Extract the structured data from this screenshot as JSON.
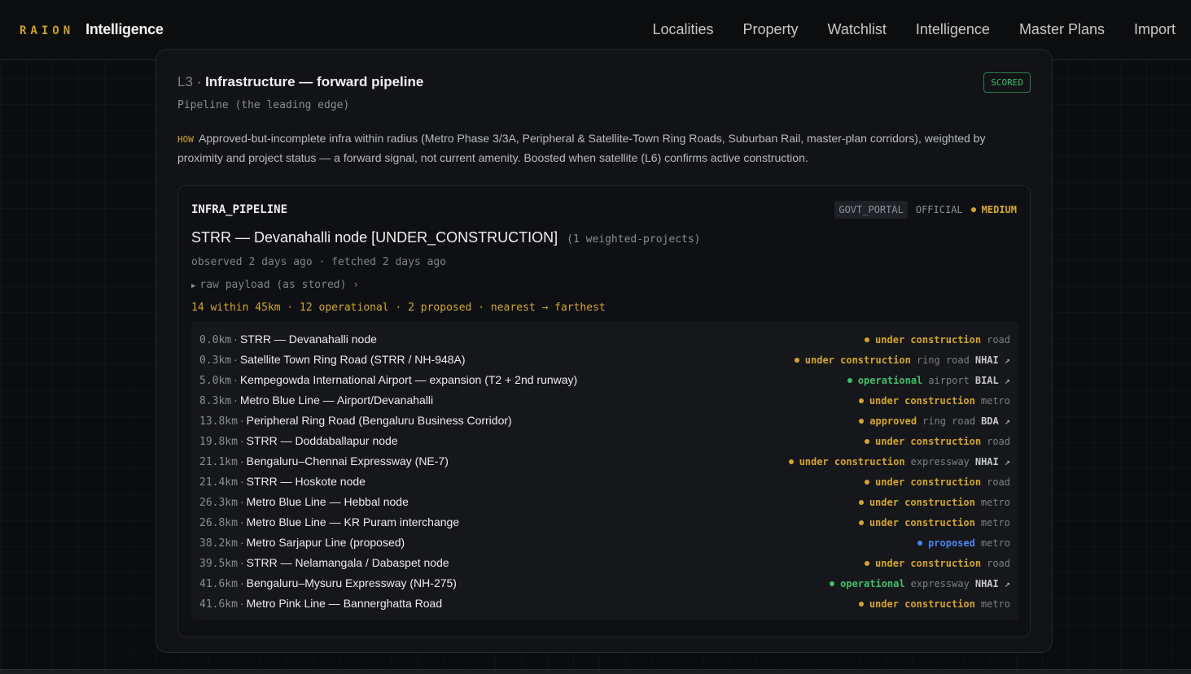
{
  "brand": {
    "prefix": "RAION",
    "name": "Intelligence"
  },
  "nav": [
    "Localities",
    "Property",
    "Watchlist",
    "Intelligence",
    "Master Plans",
    "Import"
  ],
  "colors": {
    "accent": "#d4a52a",
    "operational": "#3fbf6a",
    "proposed": "#4a86f0",
    "under_construction": "#d4a52a",
    "approved": "#d4a52a"
  },
  "card": {
    "level": "L3",
    "separator": "·",
    "title": "Infrastructure — forward pipeline",
    "badge": "SCORED",
    "subtitle": "Pipeline (the leading edge)",
    "how_tag": "HOW",
    "how_text": "Approved-but-incomplete infra within radius (Metro Phase 3/3A, Peripheral & Satellite-Town Ring Roads, Suburban Rail, master-plan corridors), weighted by proximity and project status — a forward signal, not current amenity. Boosted when satellite (L6) confirms active construction."
  },
  "panel": {
    "source_id": "INFRA_PIPELINE",
    "tag_portal": "GOVT_PORTAL",
    "tag_official": "OFFICIAL",
    "tag_confidence": "MEDIUM",
    "signal": "STRR — Devanahalli node [UNDER_CONSTRUCTION]",
    "signal_count": "(1 weighted-projects)",
    "meta": "observed 2 days ago · fetched 2 days ago",
    "raw_label": "raw payload (as stored) ›",
    "summary": "14 within 45km · 12 operational · 2 proposed · nearest → farthest"
  },
  "projects": [
    {
      "dist": "0.0km",
      "name": "STRR — Devanahalli node",
      "status": "under construction",
      "status_key": "under_construction",
      "kind": "road",
      "agency": "",
      "link": false
    },
    {
      "dist": "0.3km",
      "name": "Satellite Town Ring Road (STRR / NH-948A)",
      "status": "under construction",
      "status_key": "under_construction",
      "kind": "ring road",
      "agency": "NHAI",
      "link": true
    },
    {
      "dist": "5.0km",
      "name": "Kempegowda International Airport — expansion (T2 + 2nd runway)",
      "status": "operational",
      "status_key": "operational",
      "kind": "airport",
      "agency": "BIAL",
      "link": true
    },
    {
      "dist": "8.3km",
      "name": "Metro Blue Line — Airport/Devanahalli",
      "status": "under construction",
      "status_key": "under_construction",
      "kind": "metro",
      "agency": "",
      "link": false
    },
    {
      "dist": "13.8km",
      "name": "Peripheral Ring Road (Bengaluru Business Corridor)",
      "status": "approved",
      "status_key": "approved",
      "kind": "ring road",
      "agency": "BDA",
      "link": true
    },
    {
      "dist": "19.8km",
      "name": "STRR — Doddaballapur node",
      "status": "under construction",
      "status_key": "under_construction",
      "kind": "road",
      "agency": "",
      "link": false
    },
    {
      "dist": "21.1km",
      "name": "Bengaluru–Chennai Expressway (NE-7)",
      "status": "under construction",
      "status_key": "under_construction",
      "kind": "expressway",
      "agency": "NHAI",
      "link": true
    },
    {
      "dist": "21.4km",
      "name": "STRR — Hoskote node",
      "status": "under construction",
      "status_key": "under_construction",
      "kind": "road",
      "agency": "",
      "link": false
    },
    {
      "dist": "26.3km",
      "name": "Metro Blue Line — Hebbal node",
      "status": "under construction",
      "status_key": "under_construction",
      "kind": "metro",
      "agency": "",
      "link": false
    },
    {
      "dist": "26.8km",
      "name": "Metro Blue Line — KR Puram interchange",
      "status": "under construction",
      "status_key": "under_construction",
      "kind": "metro",
      "agency": "",
      "link": false
    },
    {
      "dist": "38.2km",
      "name": "Metro Sarjapur Line (proposed)",
      "status": "proposed",
      "status_key": "proposed",
      "kind": "metro",
      "agency": "",
      "link": false
    },
    {
      "dist": "39.5km",
      "name": "STRR — Nelamangala / Dabaspet node",
      "status": "under construction",
      "status_key": "under_construction",
      "kind": "road",
      "agency": "",
      "link": false
    },
    {
      "dist": "41.6km",
      "name": "Bengaluru–Mysuru Expressway (NH-275)",
      "status": "operational",
      "status_key": "operational",
      "kind": "expressway",
      "agency": "NHAI",
      "link": true
    },
    {
      "dist": "41.6km",
      "name": "Metro Pink Line — Bannerghatta Road",
      "status": "under construction",
      "status_key": "under_construction",
      "kind": "metro",
      "agency": "",
      "link": false
    }
  ]
}
